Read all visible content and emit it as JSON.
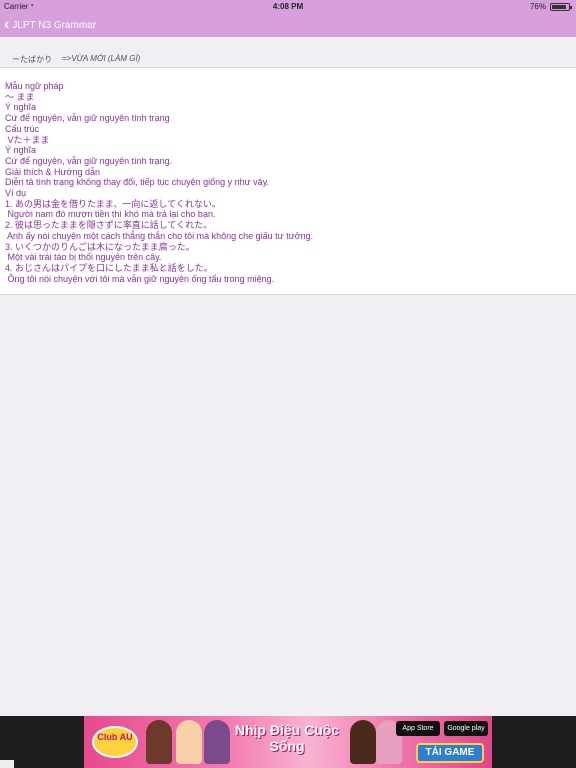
{
  "status_bar": {
    "carrier": "Carrier",
    "time": "4:08 PM",
    "battery": "76%",
    "battery_level": 0.76
  },
  "nav_bar": {
    "back_label": "JLPT N3 Grammar"
  },
  "section_header": {
    "pattern": "ーたばかり",
    "meaning": "=>VỪA MỚI (LÀM GÌ)"
  },
  "content_lines": [
    "Mẫu ngữ pháp",
    "～ まま",
    "Ý nghĩa",
    "Cứ để nguyên, vẫn giữ nguyên tình trạng",
    "Cấu trúc",
    " Vた＋まま",
    "Ý nghĩa",
    "Cứ để nguyên, vẫn giữ nguyên tình trạng.",
    "Giải thích & Hướng dẫn",
    "Diễn tả tình trạng không thay đổi, tiếp tục chuyện giống y như vậy.",
    "Ví dụ",
    "1. あの男は金を借りたまま、一向に返してくれない。",
    " Người nam đó mượn tiền thì khó mà trả lại cho bạn.",
    "2. 彼は思ったままを隠さずに率直に話してくれた。",
    " Anh ấy nói chuyện một cách thẳng thắn cho tôi mà không che giấu tư tưởng.",
    "3. いくつかのりんごは木になったまま腐った。",
    " Một vài trái táo bị thối nguyên trên cây.",
    "4. おじさんはパイプを口にしたまま私と話をした。",
    " Ông tôi nói chuyện với tôi mà vẫn giữ nguyên ống tẩu trong miệng."
  ],
  "ad": {
    "logo": "Club AU",
    "slogan": "Nhịp Điệu Cuộc Sống",
    "app_store": "App Store",
    "google_play": "Google play",
    "cta": "TẢI GAME"
  },
  "colors": {
    "bar": "#d7a0dd",
    "text": "#8e2fa6"
  }
}
